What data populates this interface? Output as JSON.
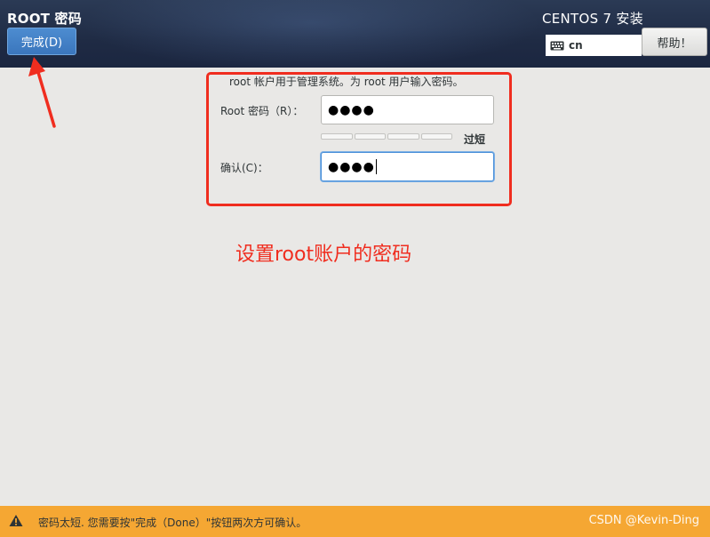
{
  "header": {
    "screen_title": "ROOT 密码",
    "done_label": "完成(D)",
    "product_title": "CENTOS 7 安装",
    "keyboard_layout": "cn",
    "help_label": "帮助！"
  },
  "form": {
    "info_text": "root 帐户用于管理系统。为 root 用户输入密码。",
    "password_label": "Root 密码（R）：",
    "password_value": "●●●●",
    "strength_label": "过短",
    "confirm_label": "确认(C)：",
    "confirm_value": "●●●●"
  },
  "annotation": {
    "caption": "设置root账户的密码",
    "color": "#f02d1f"
  },
  "warning": {
    "text": "密码太短. 您需要按\"完成（Done）\"按钮两次方可确认。",
    "color": "#f5a733"
  },
  "watermark": {
    "text": "CSDN @Kevin-Ding"
  }
}
